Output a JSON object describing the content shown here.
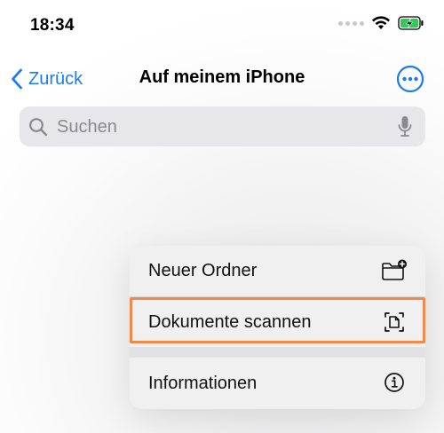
{
  "status_bar": {
    "time": "18:34",
    "icons": [
      "signal-dots",
      "wifi-icon",
      "battery-charging-icon"
    ]
  },
  "nav": {
    "back_label": "Zurück",
    "title": "Auf meinem iPhone",
    "more_icon": "ellipsis-circle-icon"
  },
  "search": {
    "placeholder": "Suchen",
    "icon": "search-icon",
    "mic_icon": "mic-icon"
  },
  "menu": {
    "items": [
      {
        "label": "Neuer Ordner",
        "icon": "folder-add-icon"
      },
      {
        "label": "Dokumente scannen",
        "icon": "doc-scan-icon"
      },
      {
        "label": "Informationen",
        "icon": "info-icon"
      }
    ]
  },
  "colors": {
    "accent": "#1a7cf0",
    "highlight": "#ef8a4b",
    "battery": "#34c759"
  }
}
